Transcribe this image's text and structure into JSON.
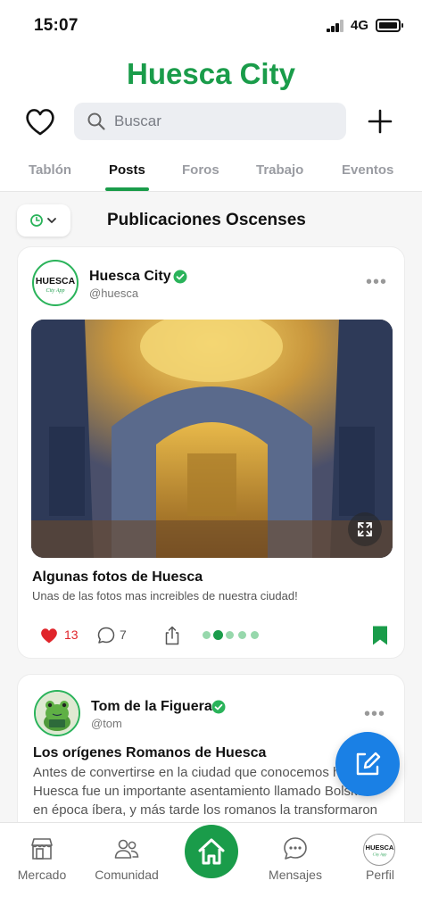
{
  "status_bar": {
    "time": "15:07",
    "network": "4G"
  },
  "app": {
    "title": "Huesca City",
    "accent_color": "#1a9c4a"
  },
  "header": {
    "favorites_icon": "heart-outline-icon",
    "search": {
      "placeholder": "Buscar",
      "icon": "search-icon"
    },
    "add_icon": "plus-icon"
  },
  "tabs": [
    {
      "label": "Tablón",
      "active": false
    },
    {
      "label": "Posts",
      "active": true
    },
    {
      "label": "Foros",
      "active": false
    },
    {
      "label": "Trabajo",
      "active": false
    },
    {
      "label": "Eventos",
      "active": false
    }
  ],
  "feed": {
    "filter_icon": "clock-icon",
    "title": "Publicaciones Oscenses",
    "posts": [
      {
        "author": "Huesca City",
        "handle": "@huesca",
        "avatar_text": "HUESCA",
        "avatar_subtext": "City App",
        "verified": true,
        "title": "Algunas fotos de Huesca",
        "subtitle": "Unas de las fotos mas increibles de nuestra ciudad!",
        "likes": "13",
        "comments": "7",
        "liked": true,
        "bookmarked": true,
        "image_count": 5,
        "active_image": 2
      },
      {
        "author": "Tom de la Figuera",
        "handle": "@tom",
        "verified": true,
        "title": "Los orígenes Romanos de Huesca",
        "excerpt": "Antes de convertirse en la ciudad que conocemos hoy, Huesca fue un importante asentamiento llamado Bolskan en época íbera, y más tarde los romanos la transformaron en"
      }
    ]
  },
  "bottom_nav": [
    {
      "label": "Mercado",
      "icon": "store-icon"
    },
    {
      "label": "Comunidad",
      "icon": "people-icon"
    },
    {
      "label": "",
      "icon": "home-icon"
    },
    {
      "label": "Mensajes",
      "icon": "chat-icon"
    },
    {
      "label": "Perfil",
      "icon": "profile-avatar"
    }
  ],
  "profile_avatar_text": "HUESCA",
  "profile_avatar_subtext": "City App"
}
